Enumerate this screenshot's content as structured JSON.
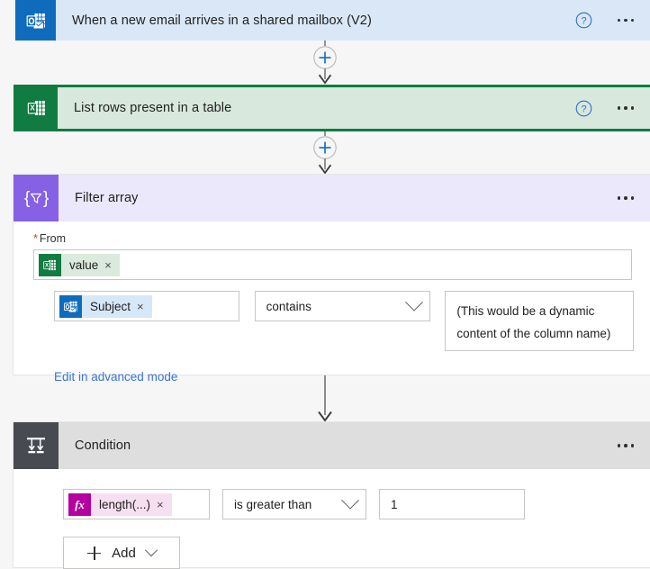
{
  "flow": {
    "steps": [
      {
        "id": "trigger",
        "title": "When a new email arrives in a shared mailbox (V2)",
        "connector": "outlook",
        "icon_name": "outlook-icon",
        "header_bg": "#d9e7f7",
        "icon_bg": "#0f6cbd",
        "has_help": true,
        "has_menu": true
      },
      {
        "id": "excel",
        "title": "List rows present in a table",
        "connector": "excel",
        "icon_name": "excel-icon",
        "header_bg": "#d8e8dc",
        "icon_bg": "#107c41",
        "selected": true,
        "selection_color": "#107c41",
        "has_help": true,
        "has_menu": true
      },
      {
        "id": "filter",
        "title": "Filter array",
        "connector": "filter-array",
        "icon_name": "filter-array-icon",
        "header_bg": "#ece8fb",
        "icon_bg": "#8661e5",
        "has_help": false,
        "has_menu": true
      },
      {
        "id": "condition",
        "title": "Condition",
        "connector": "control",
        "icon_name": "condition-icon",
        "header_bg": "#dedede",
        "icon_bg": "#484a52",
        "has_help": false,
        "has_menu": true
      }
    ],
    "connectors": [
      {
        "id": "c1",
        "type": "plus-arrow"
      },
      {
        "id": "c2",
        "type": "plus-arrow"
      },
      {
        "id": "c3",
        "type": "arrow"
      }
    ]
  },
  "filter_array": {
    "from_label": "From",
    "required_marker": "*",
    "from_token": {
      "text": "value",
      "icon_name": "excel-icon",
      "remove_label": "×",
      "pill_bg": "#daeadd"
    },
    "condition_row": {
      "left_token": {
        "text": "Subject",
        "icon_name": "outlook-icon",
        "remove_label": "×",
        "pill_bg": "#d6e7f8"
      },
      "operator": "contains",
      "operator_chevron": "chevron-down-icon",
      "right_value": "(This would be a dynamic content of the column name)"
    },
    "advanced_link": "Edit in advanced mode"
  },
  "condition": {
    "left_token": {
      "text": "length(...)",
      "icon_name": "function-fx-icon",
      "icon_label": "fx",
      "remove_label": "×",
      "pill_bg": "#f6dff0"
    },
    "operator": "is greater than",
    "operator_chevron": "chevron-down-icon",
    "right_value": "1",
    "add_button": {
      "label": "Add",
      "plus_icon": "plus-icon",
      "chevron_icon": "chevron-down-icon"
    }
  },
  "icons": {
    "help": "?",
    "menu_dots": "•••",
    "filter_array_glyph": "{▽}"
  },
  "colors": {
    "canvas_bg": "#f6f6f6",
    "accent_blue": "#0f6cbd",
    "link_blue": "#3a73d8",
    "excel_green": "#107c41",
    "filter_purple": "#8661e5",
    "condition_gray": "#484a52",
    "fx_magenta": "#b4009e",
    "required_red": "#d13438"
  }
}
